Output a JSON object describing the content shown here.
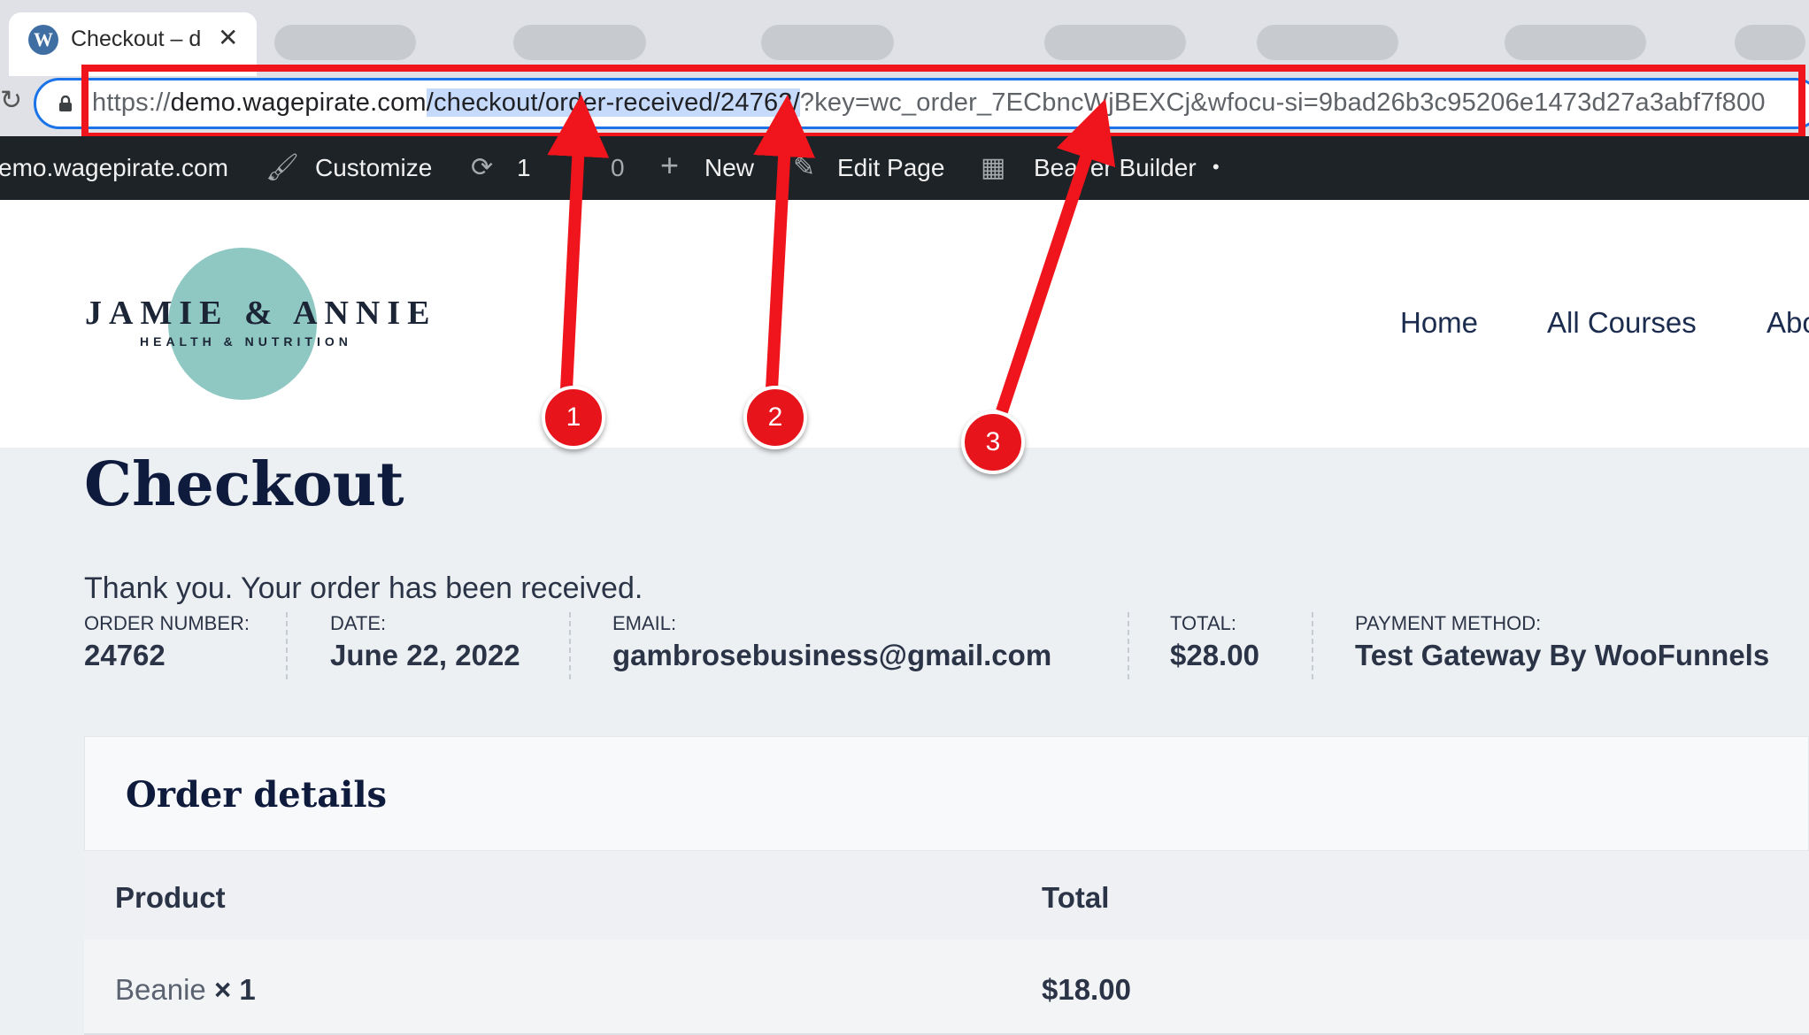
{
  "browser": {
    "tab_title": "Checkout – d",
    "url": {
      "scheme": "https://",
      "domain": "demo.wagepirate.com",
      "path_selected": "/checkout/order-received/24762/",
      "query": "?key=wc_order_7ECbncWjBEXCj&wfocu-si=9bad26b3c95206e1473d27a3abf7f800"
    }
  },
  "admin_bar": {
    "site": "emo.wagepirate.com",
    "customize": "Customize",
    "updates_count": "1",
    "comments_count": "0",
    "new": "New",
    "edit_page": "Edit Page",
    "builder": "Beaver Builder",
    "builder_dot": "•"
  },
  "site": {
    "logo_main": "JAMIE & ANNIE",
    "logo_sub": "HEALTH & NUTRITION",
    "nav": [
      "Home",
      "All Courses",
      "Abo"
    ]
  },
  "page": {
    "title": "Checkout",
    "thanks": "Thank you. Your order has been received.",
    "overview": [
      {
        "label": "ORDER NUMBER:",
        "value": "24762"
      },
      {
        "label": "DATE:",
        "value": "June 22, 2022"
      },
      {
        "label": "EMAIL:",
        "value": "gambrosebusiness@gmail.com"
      },
      {
        "label": "TOTAL:",
        "value": "$28.00"
      },
      {
        "label": "PAYMENT METHOD:",
        "value": "Test Gateway By WooFunnels"
      }
    ],
    "order_details": {
      "title": "Order details",
      "columns": [
        "Product",
        "Total"
      ],
      "rows": [
        {
          "product": "Beanie",
          "qty": "× 1",
          "total": "$18.00"
        }
      ]
    }
  },
  "annotations": {
    "badges": [
      "1",
      "2",
      "3"
    ],
    "color": "#e8141c"
  }
}
